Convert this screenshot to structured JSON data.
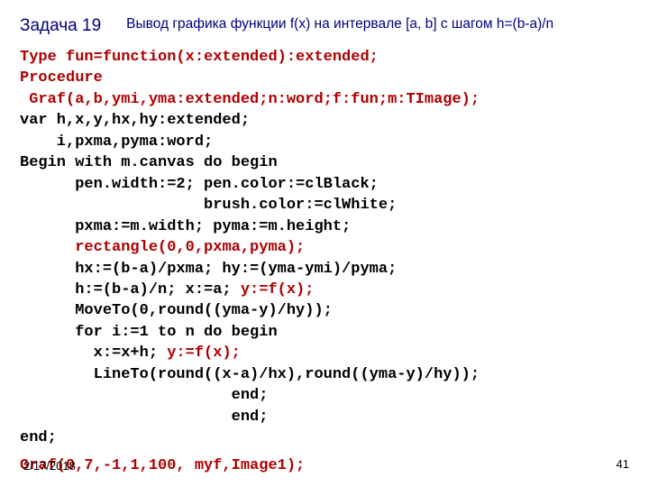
{
  "header": {
    "task_label": "Задача 19",
    "subtitle": "Вывод графика функции f(x) на интервале [a, b] с шагом h=(b-a)/n"
  },
  "code": {
    "l01a": "Type fun=function(x:extended):extended;",
    "l02a": "Procedure",
    "l03a": " Graf(a,b,ymi,yma:extended;n:word;f:fun;m:TImage);",
    "l04": "var h,x,y,hx,hy:extended;",
    "l05": "    i,pxma,pyma:word;",
    "l06": "Begin with m.canvas do begin",
    "l07": "      pen.width:=2; pen.color:=clBlack;",
    "l08": "                    brush.color:=clWhite;",
    "l09": "      pxma:=m.width; pyma:=m.height;",
    "l10a": "      ",
    "l10b": "rectangle(0,0,pxma,pyma);",
    "l11": "      hx:=(b-a)/pxma; hy:=(yma-ymi)/pyma;",
    "l12a": "      h:=(b-a)/n; x:=a; ",
    "l12b": "y:=f(x);",
    "l13": "      MoveTo(0,round((yma-y)/hy));",
    "l14": "      for i:=1 to n do begin",
    "l15a": "        x:=x+h; ",
    "l15b": "y:=f(x);",
    "l16": "        LineTo(round((x-a)/hx),round((yma-y)/hy));",
    "l17": "                       end;",
    "l18": "                       end;",
    "l19": "end;"
  },
  "footer": {
    "date": "2/17/2018",
    "call": "Graf(0,7,-1,1,100, myf,Image1);",
    "page": "41"
  }
}
